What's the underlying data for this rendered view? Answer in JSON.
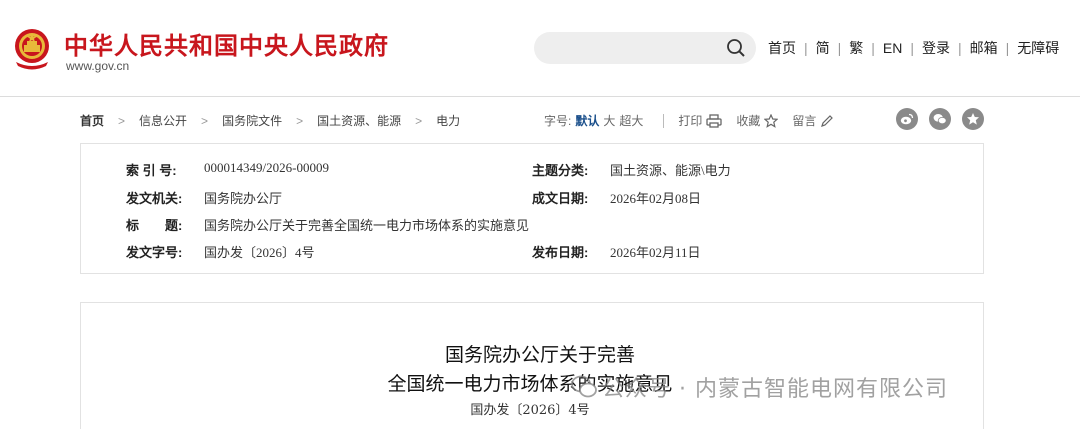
{
  "header": {
    "site_title": "中华人民共和国中央人民政府",
    "site_url": "www.gov.cn",
    "nav": [
      "首页",
      "简",
      "繁",
      "EN",
      "登录",
      "邮箱",
      "无障碍"
    ]
  },
  "breadcrumb": [
    "首页",
    "信息公开",
    "国务院文件",
    "国土资源、能源",
    "电力"
  ],
  "tools": {
    "font_label": "字号:",
    "font_sizes": [
      "默认",
      "大",
      "超大"
    ],
    "print": "打印",
    "favorite": "收藏",
    "comment": "留言"
  },
  "meta": {
    "index_label": "索 引 号:",
    "index_value": "000014349/2026-00009",
    "category_label": "主题分类:",
    "category_value": "国土资源、能源\\电力",
    "issuer_label": "发文机关:",
    "issuer_value": "国务院办公厅",
    "written_label": "成文日期:",
    "written_value": "2026年02月08日",
    "title_label": "标　　题:",
    "title_value": "国务院办公厅关于完善全国统一电力市场体系的实施意见",
    "docno_label": "发文字号:",
    "docno_value": "国办发〔2026〕4号",
    "published_label": "发布日期:",
    "published_value": "2026年02月11日"
  },
  "document": {
    "title_line1": "国务院办公厅关于完善",
    "title_line2": "全国统一电力市场体系的实施意见",
    "doc_number": "国办发〔2026〕4号"
  },
  "watermark": "公众号 · 内蒙古智能电网有限公司",
  "colors": {
    "brand_red": "#c8161d",
    "link_blue": "#1a4f8b"
  }
}
